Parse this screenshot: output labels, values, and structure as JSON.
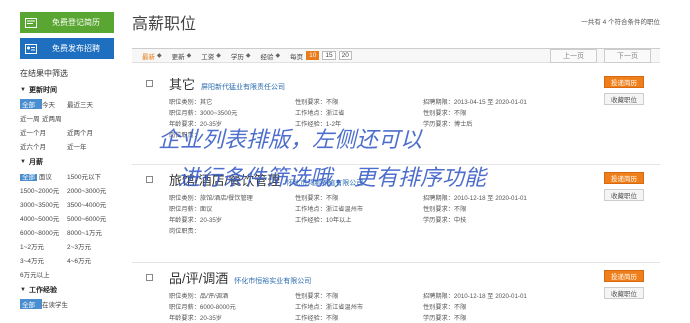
{
  "sidebar": {
    "btn_resume": "免费登记简历",
    "btn_post": "免费发布招聘",
    "filter_title": "在结果中筛选",
    "sections": [
      {
        "title": "更新时间",
        "options": [
          "全部",
          "今天",
          "最近三天",
          "近一周",
          "近两周",
          "近一个月",
          "近两个月",
          "近六个月",
          "近一年"
        ],
        "selected": "全部"
      },
      {
        "title": "月薪",
        "options": [
          "全部",
          "面议",
          "1500元以下",
          "1500~2000元",
          "2000~3000元",
          "3000~3500元",
          "3500~4000元",
          "4000~5000元",
          "5000~6000元",
          "6000~8000元",
          "8000~1万元",
          "1~2万元",
          "2~3万元",
          "3~4万元",
          "4~6万元",
          "6万元以上"
        ],
        "selected": "全部"
      },
      {
        "title": "工作经验",
        "options": [
          "全部",
          "在读学生"
        ],
        "selected": "全部"
      }
    ]
  },
  "main": {
    "title": "高薪职位",
    "count": "一共有 4 个符合条件的职位",
    "toolbar": {
      "sorts": [
        {
          "label": "最新",
          "active": true
        },
        {
          "label": "更新",
          "active": false
        },
        {
          "label": "工资",
          "active": false
        },
        {
          "label": "学历",
          "active": false
        },
        {
          "label": "经验",
          "active": false
        }
      ],
      "per_page_label": "每页",
      "per_page": [
        "10",
        "15",
        "20"
      ],
      "prev": "上一页",
      "next": "下一页"
    },
    "jobs": [
      {
        "title": "其它",
        "company": "屏阳新代猛业有限责任公司",
        "rows": [
          [
            "职位类别：其它",
            "性别要求：不限",
            "招聘期限：2013-04-15 至 2020-01-01"
          ],
          [
            "职位月薪：3000~3500元",
            "工作地点：浙江省",
            "性别要求：不限"
          ],
          [
            "年龄要求：20-35岁",
            "工作经验：1-2年",
            "学历要求：博士后"
          ],
          [
            "岗位职责：",
            "",
            ""
          ]
        ]
      },
      {
        "title": "旅馆/酒店/餐饮管理",
        "company": "怀化市鸿鹏养殖有限公司",
        "rows": [
          [
            "职位类别：旅馆/酒店/餐饮管理",
            "性别要求：不限",
            "招聘期限：2010-12-18 至 2020-01-01"
          ],
          [
            "职位月薪：面议",
            "工作地点：浙江省温州市",
            "性别要求：不限"
          ],
          [
            "年龄要求：20-35岁",
            "工作经验：10年以上",
            "学历要求：中技"
          ],
          [
            "岗位职责：",
            "",
            ""
          ]
        ]
      },
      {
        "title": "品/评/调酒",
        "company": "怀化市恒裕实业有限公司",
        "rows": [
          [
            "职位类别：品/评/调酒",
            "性别要求：不限",
            "招聘期限：2010-12-18 至 2020-01-01"
          ],
          [
            "职位月薪：6000-8000元",
            "工作地点：浙江省温州市",
            "性别要求：不限"
          ],
          [
            "年龄要求：20-35岁",
            "工作经验：不限",
            "学历要求：不限"
          ]
        ]
      }
    ],
    "apply_label": "投递简历",
    "fav_label": "收藏职位"
  },
  "annotation": {
    "line1": "企业列表排版，左侧还可以",
    "line2": "进行条件筛选哦，更有排序功能"
  }
}
